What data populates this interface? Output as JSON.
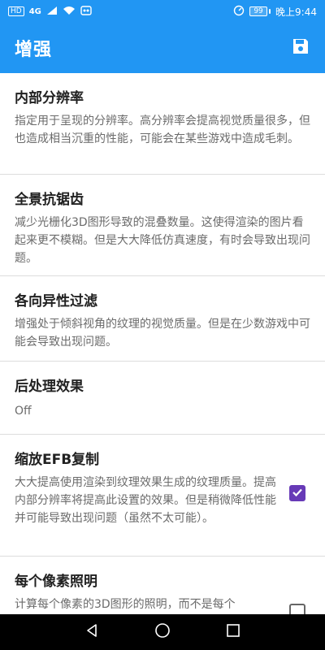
{
  "status_bar": {
    "hd_label": "HD",
    "network_label": "4G",
    "signal_icon": "signal-icon",
    "wifi_icon": "wifi-icon",
    "app_notification_icon": "notification-icon",
    "speed_icon": "speedometer-icon",
    "battery_level": "99",
    "time": "晚上9:44"
  },
  "appbar": {
    "title": "增强",
    "save_icon": "floppy-disk-icon"
  },
  "settings": [
    {
      "title": "内部分辨率",
      "description": "指定用于呈现的分辨率。高分辨率会提高视觉质量很多，但也造成相当沉重的性能，可能会在某些游戏中造成毛刺。"
    },
    {
      "title": "全景抗锯齿",
      "description": "减少光栅化3D图形导致的混叠数量。这使得渲染的图片看起来更不模糊。但是大大降低仿真速度，有时会导致出现问题。"
    },
    {
      "title": "各向异性过滤",
      "description": "增强处于倾斜视角的纹理的视觉质量。但是在少数游戏中可能会导致出现问题。"
    },
    {
      "title": "后处理效果",
      "value": "Off"
    },
    {
      "title": "缩放EFB复制",
      "description": "大大提高使用渲染到纹理效果生成的纹理质量。提高内部分辨率将提高此设置的效果。但是稍微降低性能并可能导致出现问题（虽然不太可能）。",
      "checked": true
    },
    {
      "title": "每个像素照明",
      "description": "计算每个像素的3D图形的照明，而不是每个",
      "checked": false
    }
  ],
  "navigation": {
    "back_icon": "back-triangle-icon",
    "home_icon": "home-circle-icon",
    "recents_icon": "recents-square-icon"
  },
  "colors": {
    "primary": "#2196F3",
    "checkbox_checked": "#673AB7",
    "title_text": "#212121",
    "secondary_text": "#6b6b6b",
    "navbar": "#000000"
  }
}
